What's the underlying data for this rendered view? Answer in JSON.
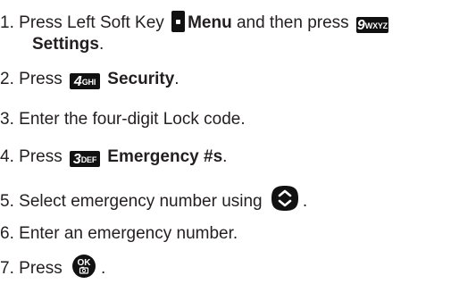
{
  "steps": [
    {
      "number": "1.",
      "text_before": "Press Left Soft Key",
      "key_icon": "left-soft-key-icon",
      "bold_label": "Menu",
      "text_middle": "and then press",
      "key2": {
        "digit": "9",
        "letters": "WXYZ"
      },
      "bold_label_2": "Settings",
      "suffix": "."
    },
    {
      "number": "2.",
      "text_before": "Press",
      "key": {
        "digit": "4",
        "letters": "GHI"
      },
      "bold_label": "Security",
      "suffix": "."
    },
    {
      "number": "3.",
      "text": "Enter the four-digit Lock code."
    },
    {
      "number": "4.",
      "text_before": "Press",
      "key": {
        "digit": "3",
        "letters": "DEF"
      },
      "bold_label": "Emergency #s",
      "suffix": "."
    },
    {
      "number": "5.",
      "text_before": "Select emergency number using",
      "key_icon": "navigation-key-icon",
      "suffix": "."
    },
    {
      "number": "6.",
      "text": "Enter an emergency number."
    },
    {
      "number": "7.",
      "text_before": "Press",
      "key": {
        "label": "OK"
      },
      "suffix": "."
    }
  ],
  "colors": {
    "text": "#231f20",
    "key_fill": "#111111",
    "key_text": "#ffffff"
  }
}
